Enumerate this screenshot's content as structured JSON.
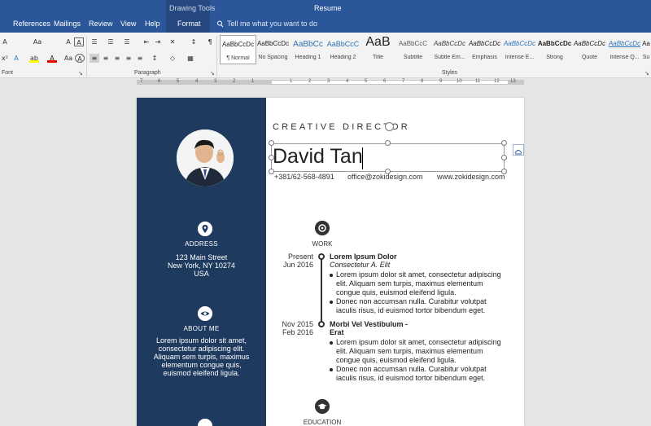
{
  "window": {
    "contextual_tab_group": "Drawing Tools",
    "doc_title": "Resume"
  },
  "tabs": [
    {
      "label": "References"
    },
    {
      "label": "Mailings"
    },
    {
      "label": "Review"
    },
    {
      "label": "View"
    },
    {
      "label": "Help"
    },
    {
      "label": "Format"
    }
  ],
  "tell_me": {
    "placeholder": "Tell me what you want to do"
  },
  "ribbon": {
    "font_group_label": "Font",
    "paragraph_group_label": "Paragraph",
    "styles_group_label": "Styles",
    "font_size_case": "Aa",
    "styles": [
      {
        "preview": "AaBbCcDc",
        "name": "¶ Normal"
      },
      {
        "preview": "AaBbCcDc",
        "name": "No Spacing"
      },
      {
        "preview": "AaBbCc",
        "name": "Heading 1"
      },
      {
        "preview": "AaBbCcC",
        "name": "Heading 2"
      },
      {
        "preview": "AaB",
        "name": "Title"
      },
      {
        "preview": "AaBbCcC",
        "name": "Subtitle"
      },
      {
        "preview": "AaBbCcDc",
        "name": "Subtle Em..."
      },
      {
        "preview": "AaBbCcDc",
        "name": "Emphasis"
      },
      {
        "preview": "AaBbCcDc",
        "name": "Intense E..."
      },
      {
        "preview": "AaBbCcDc",
        "name": "Strong"
      },
      {
        "preview": "AaBbCcDc",
        "name": "Quote"
      },
      {
        "preview": "AaBbCcDc",
        "name": "Intense Q..."
      },
      {
        "preview": "Aa",
        "name": "Su"
      }
    ]
  },
  "ruler": {
    "left_numbers": [
      "7",
      "6",
      "5",
      "4",
      "3",
      "2",
      "1"
    ],
    "right_numbers": [
      "1",
      "2",
      "3",
      "4",
      "5",
      "6",
      "7",
      "8",
      "9",
      "10",
      "11",
      "12",
      "13"
    ]
  },
  "resume": {
    "job_title": "CREATIVE DIRECTOR",
    "name": "David Tan",
    "phone": "+381/62-568-4891",
    "email": "office@zokidesign.com",
    "website": "www.zokidesign.com",
    "address_title": "ADDRESS",
    "address_line1": "123 Main Street",
    "address_line2": "New York, NY 10274",
    "address_line3": "USA",
    "about_title": "ABOUT ME",
    "about_line1": "Lorem ipsum dolor sit amet,",
    "about_line2": "consectetur adipiscing elit.",
    "about_line3": "Aliquam sem turpis, maximus",
    "about_line4": "elementum congue quis,",
    "about_line5": "euismod eleifend ligula.",
    "work_title": "WORK",
    "education_title": "EDUCATION",
    "jobs": [
      {
        "date_start": "Present",
        "date_end": "Jun 2016",
        "title": "Lorem Ipsum Dolor",
        "subtitle": "Consectetur A. Elit",
        "bullets": [
          "Lorem ipsum dolor sit amet, consectetur adipiscing elit. Aliquam sem turpis, maximus elementum congue quis, euismod eleifend ligula.",
          "Donec non accumsan nulla. Curabitur volutpat iaculis risus, id euismod tortor bibendum eget."
        ]
      },
      {
        "date_start": "Nov 2015",
        "date_end": "Feb 2016",
        "title": "Morbi Vel Vestibulum -",
        "title2": "Erat",
        "bullets": [
          "Lorem ipsum dolor sit amet, consectetur adipiscing elit. Aliquam sem turpis, maximus elementum congue quis, euismod eleifend ligula.",
          "Donec non accumsan nulla. Curabitur volutpat iaculis risus, id euismod tortor bibendum eget."
        ]
      }
    ]
  },
  "colors": {
    "title_bar": "#2b579a",
    "sidebar": "#1f3a5f",
    "ribbon": "#f3f3f3"
  }
}
